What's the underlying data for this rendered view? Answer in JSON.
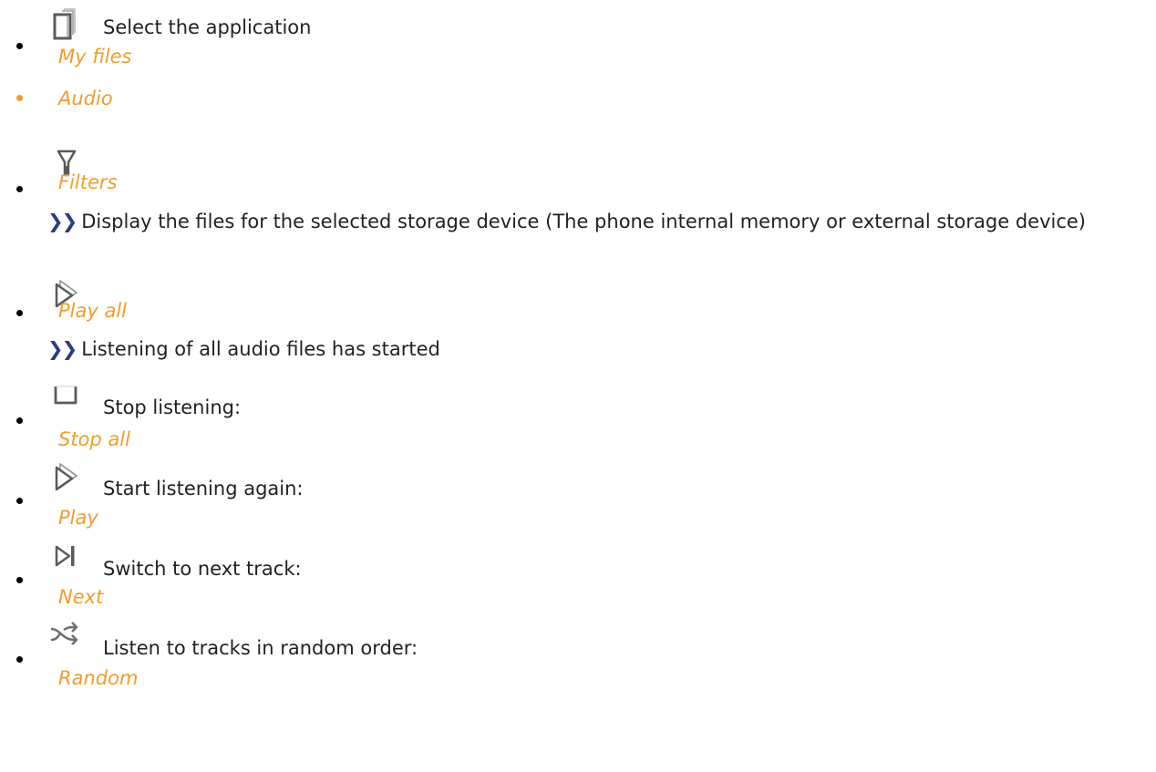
{
  "steps": [
    {
      "icon": "files-stack-icon",
      "text": "Select the application",
      "label": "My files"
    },
    {
      "label": "Audio"
    },
    {
      "icon": "filter-icon",
      "label": "Filters",
      "result": "Display the files for the selected storage device (The phone internal memory or external storage device)"
    },
    {
      "icon": "play-all-icon",
      "label": "Play all",
      "result": "Listening of all audio files has started"
    },
    {
      "icon": "stop-icon",
      "text": "Stop listening:",
      "label": "Stop all"
    },
    {
      "icon": "play-icon",
      "text": "Start listening again:",
      "label": "Play"
    },
    {
      "icon": "next-track-icon",
      "text": "Switch to next track:",
      "label": "Next"
    },
    {
      "icon": "shuffle-icon",
      "text": "Listen to tracks in random order:",
      "label": "Random"
    }
  ],
  "result_marker": "❯❯",
  "colors": {
    "label": "#f39c2c",
    "text": "#231f20",
    "result_marker": "#2e3a87",
    "icon": "#6d6e71"
  }
}
